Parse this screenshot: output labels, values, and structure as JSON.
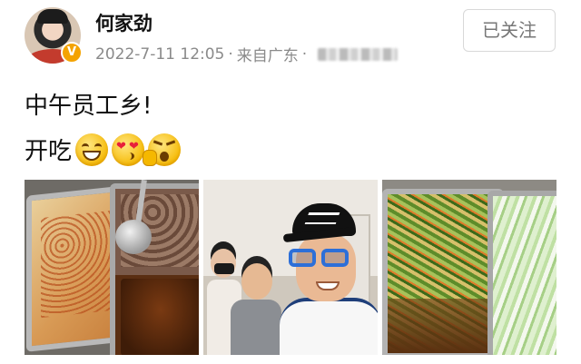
{
  "user": {
    "name": "何家劲",
    "verified_icon": "v-verified-badge"
  },
  "meta": {
    "timestamp": "2022-7-11 12:05",
    "separator": "·",
    "source": "来自广东"
  },
  "follow_button": {
    "label": "已关注"
  },
  "post": {
    "line1": "中午员工乡!",
    "line2": "开吃",
    "emojis": [
      "grinning-face-icon",
      "heart-eyes-kiss-icon",
      "shocked-face-icon"
    ]
  },
  "photos": [
    {
      "name": "food-trays-photo"
    },
    {
      "name": "staff-selfie-photo"
    },
    {
      "name": "vegetable-trays-photo"
    }
  ],
  "colors": {
    "verified_badge": "#f4a300",
    "meta_text": "#8a8a8a",
    "button_border": "#d8d8d8"
  }
}
